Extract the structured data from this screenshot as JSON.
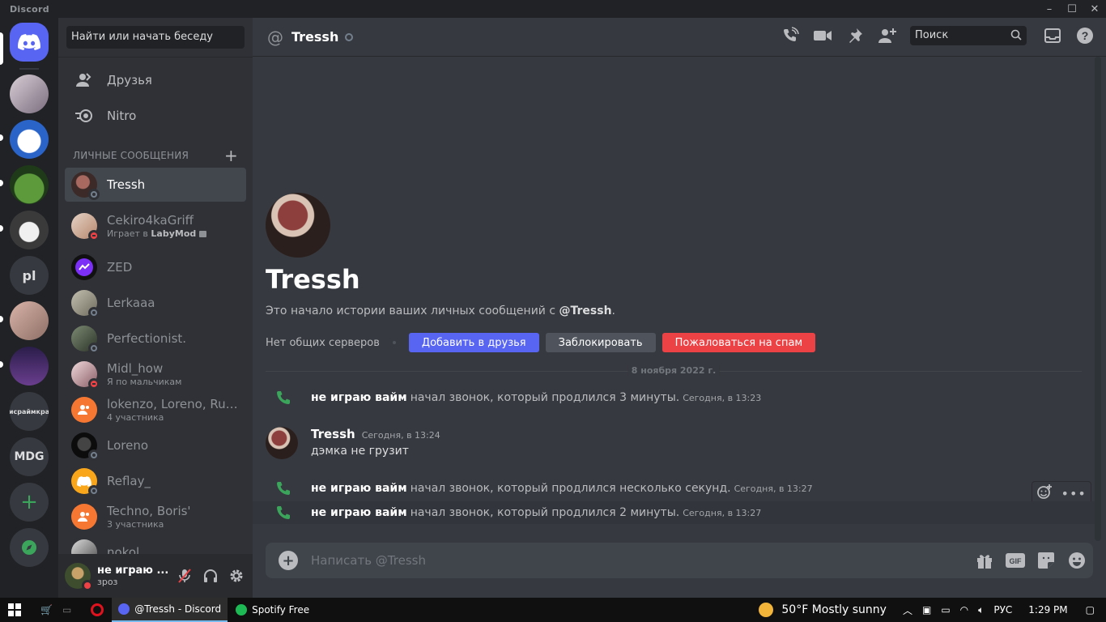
{
  "window": {
    "brand": "Discord"
  },
  "servers": [
    {
      "id": "home",
      "label": ""
    },
    {
      "id": "s1",
      "label": ""
    },
    {
      "id": "s2",
      "label": ""
    },
    {
      "id": "s3",
      "label": ""
    },
    {
      "id": "s4",
      "label": ""
    },
    {
      "id": "s5",
      "label": "pl"
    },
    {
      "id": "s6",
      "label": ""
    },
    {
      "id": "s7",
      "label": ""
    },
    {
      "id": "s8",
      "label": "исраймкра"
    },
    {
      "id": "s9",
      "label": "MDG"
    }
  ],
  "sidebar": {
    "search_label": "Найти или начать беседу",
    "nav": [
      {
        "label": "Друзья",
        "icon": "friends-icon"
      },
      {
        "label": "Nitro",
        "icon": "nitro-icon"
      }
    ],
    "section_title": "ЛИЧНЫЕ СООБЩЕНИЯ",
    "dms": [
      {
        "name": "Tressh",
        "sub": "",
        "status": "offline",
        "color": "#6b4a44"
      },
      {
        "name": "Cekiro4kaGriff",
        "sub_prefix": "Играет в ",
        "sub_bold": "LabyMod",
        "status": "dnd",
        "color": "#c9a89c"
      },
      {
        "name": "ZED",
        "sub": "",
        "status": "none",
        "color": "#3a1a6e"
      },
      {
        "name": "Lerkaaa",
        "sub": "",
        "status": "offline",
        "color": "#8c8c7a"
      },
      {
        "name": "Perfectionist.",
        "sub": "",
        "status": "offline",
        "color": "#4c5a4a"
      },
      {
        "name": "Midl_how",
        "sub": "Я по мальчикам",
        "status": "dnd",
        "color": "#b08a90"
      },
      {
        "name": "lokenzo, Loreno, RuNe...",
        "sub": "4 участника",
        "status": "none",
        "color": "#f57731"
      },
      {
        "name": "Loreno",
        "sub": "",
        "status": "offline",
        "color": "#1a1a1a"
      },
      {
        "name": "Reflay_",
        "sub": "",
        "status": "offline",
        "color": "#faa61a"
      },
      {
        "name": "Techno, Boris'",
        "sub": "3 участника",
        "status": "none",
        "color": "#f57731"
      },
      {
        "name": "nokol",
        "sub": "",
        "status": "offline",
        "color": "#7a7a7a"
      }
    ]
  },
  "user_panel": {
    "name": "не играю ...",
    "tag": "зроз"
  },
  "chat": {
    "header_title": "Tressh",
    "search_placeholder": "Поиск",
    "intro_name": "Tressh",
    "intro_text_prefix": "Это начало истории ваших личных сообщений с ",
    "intro_text_user": "@Tressh",
    "intro_text_suffix": ".",
    "no_mutual": "Нет общих серверов",
    "btn_add": "Добавить в друзья",
    "btn_block": "Заблокировать",
    "btn_spam": "Пожаловаться на спам",
    "date_divider": "8 ноября 2022 г.",
    "calls": [
      {
        "who": "не играю вайм",
        "what": "начал звонок, который продлился 3 минуты.",
        "when": "Сегодня, в 13:23"
      },
      {
        "who": "не играю вайм",
        "what": "начал звонок, который продлился несколько секунд.",
        "when": "Сегодня, в 13:27"
      },
      {
        "who": "не играю вайм",
        "what": "начал звонок, который продлился 2 минуты.",
        "when": "Сегодня, в 13:27"
      }
    ],
    "message": {
      "author": "Tressh",
      "time": "Сегодня, в 13:24",
      "text": "дэмка не грузит"
    },
    "composer_placeholder": "Написать @Tressh"
  },
  "taskbar": {
    "apps": [
      {
        "label": "@Tressh - Discord"
      },
      {
        "label": "Spotify Free"
      }
    ],
    "weather": "50°F  Mostly sunny",
    "lang": "РУС",
    "time": "1:29 PM"
  },
  "colors": {
    "accent": "#5865f2",
    "danger": "#ed4245",
    "call_green": "#3ba55c"
  }
}
